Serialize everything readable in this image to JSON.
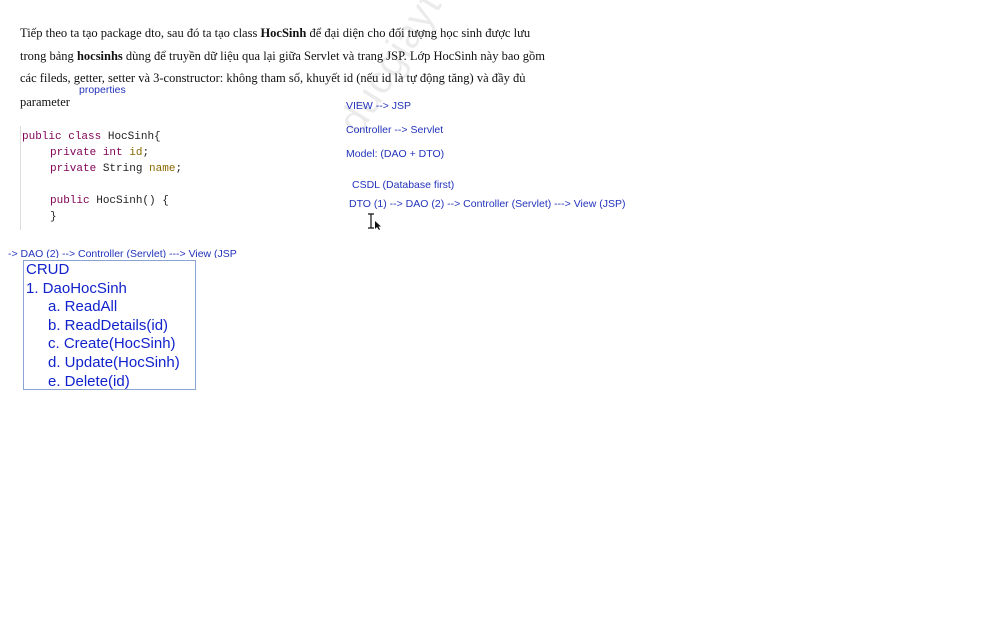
{
  "document": {
    "line1_prefix": "Tiếp theo ta tạo package dto, sau đó ta tạo class ",
    "line1_bold": "HocSinh",
    "line1_suffix": " để đại diện cho đối tượng học sinh được lưu",
    "line2_prefix": "trong bảng ",
    "line2_bold": "hocsinhs",
    "line2_suffix": " dùng để truyền dữ liệu qua lại giữa Servlet và trang JSP. Lớp HocSinh này bao gồm",
    "line3": "các fileds, getter, setter và 3-constructor: không tham số, khuyết id (nếu id là tự động tăng) và đầy đủ",
    "line4": "parameter"
  },
  "annotations": {
    "properties": "properties",
    "view_jsp": "VIEW --> JSP",
    "controller_servlet": "Controller --> Servlet",
    "model": "Model: (DAO + DTO)",
    "csdl": "CSDL (Database first)",
    "flow": "DTO (1) --> DAO (2) --> Controller (Servlet) ---> View (JSP)",
    "flow_clipped": "-> DAO (2) --> Controller (Servlet) ---> View (JSP"
  },
  "code": {
    "kw_public": "public",
    "kw_class": "class",
    "class_name": "HocSinh{",
    "kw_private": "private",
    "kw_int": "int",
    "field_id": "id",
    "type_string": "String",
    "field_name": "name",
    "semicolon": ";",
    "ctor": "HocSinh() {",
    "close_brace": "}"
  },
  "crud": {
    "title": "CRUD",
    "item1": "1. DaoHocSinh",
    "a": "a. ReadAll",
    "b": "b. ReadDetails(id)",
    "c": "c. Create(HocSinh)",
    "d": "d. Update(HocSinh)",
    "e": "e. Delete(id)"
  },
  "watermark": "ducgiaytt@gmail.co",
  "colors": {
    "note_blue": "#2233bb",
    "crud_blue": "#1122cc",
    "keyword": "#7f0055",
    "field": "#8b6a00"
  },
  "icons": {
    "cursor": "text-cursor-ibeam"
  }
}
